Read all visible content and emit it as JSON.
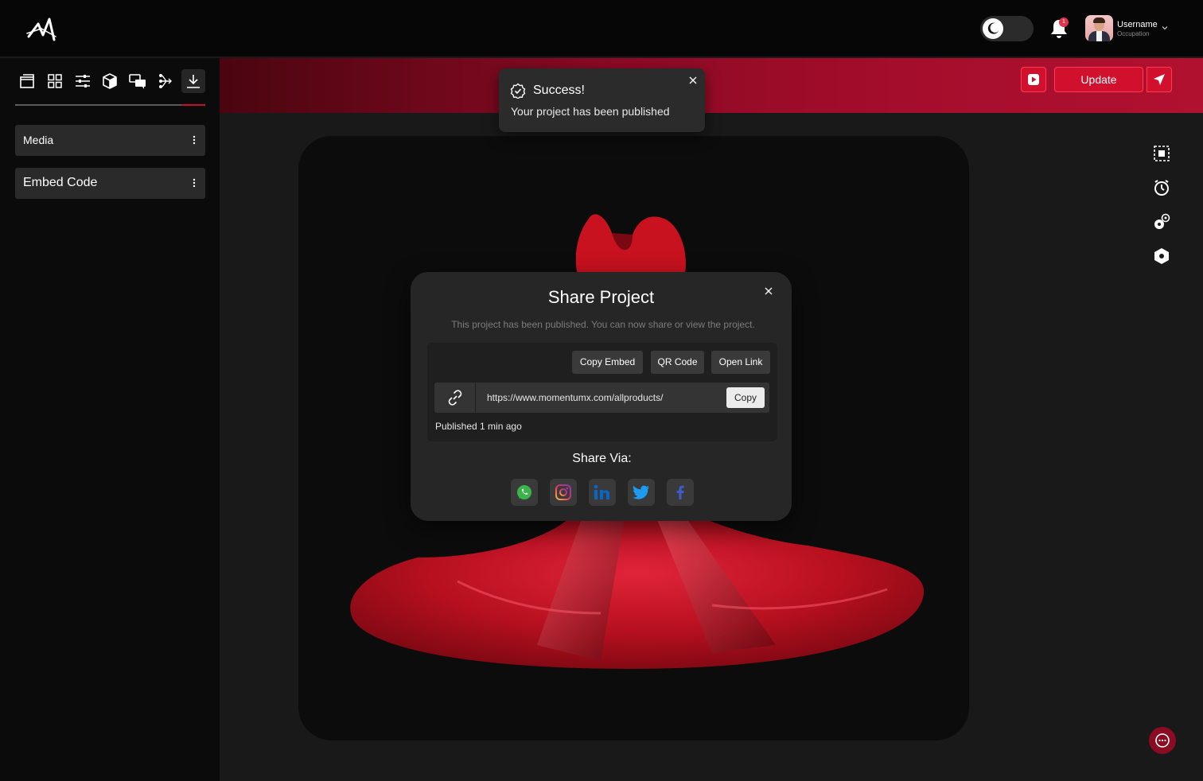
{
  "header": {
    "user_name": "Username",
    "user_occupation": "Occupation",
    "notification_count": "1",
    "theme_mode": "dark"
  },
  "sidebar": {
    "tools": [
      {
        "name": "scene-icon",
        "active": false
      },
      {
        "name": "grid-icon",
        "active": false
      },
      {
        "name": "sliders-icon",
        "active": false
      },
      {
        "name": "cube-icon",
        "active": false
      },
      {
        "name": "chat-bubbles-icon",
        "active": false
      },
      {
        "name": "flow-icon",
        "active": false
      },
      {
        "name": "download-icon",
        "active": true
      }
    ],
    "items": [
      {
        "label": "Media"
      },
      {
        "label": "Embed Code"
      }
    ]
  },
  "toolbar": {
    "update_label": "Update"
  },
  "toast": {
    "title": "Success!",
    "message": "Your project has been published"
  },
  "modal": {
    "title": "Share Project",
    "subtitle": "This project has been published. You can now share or view the project.",
    "actions": [
      "Copy Embed",
      "QR Code",
      "Open Link"
    ],
    "url": "https://www.momentumx.com/allproducts/",
    "copy_label": "Copy",
    "published_text": "Published 1 min ago",
    "share_via_label": "Share Via:",
    "socials": [
      "whatsapp-icon",
      "instagram-icon",
      "linkedin-icon",
      "twitter-icon",
      "facebook-icon"
    ]
  },
  "colors": {
    "accent": "#d0102c",
    "band_dark": "#4a0510",
    "band_light": "#b0112f",
    "background": "#191919",
    "sidebar": "#0b0b0b"
  }
}
